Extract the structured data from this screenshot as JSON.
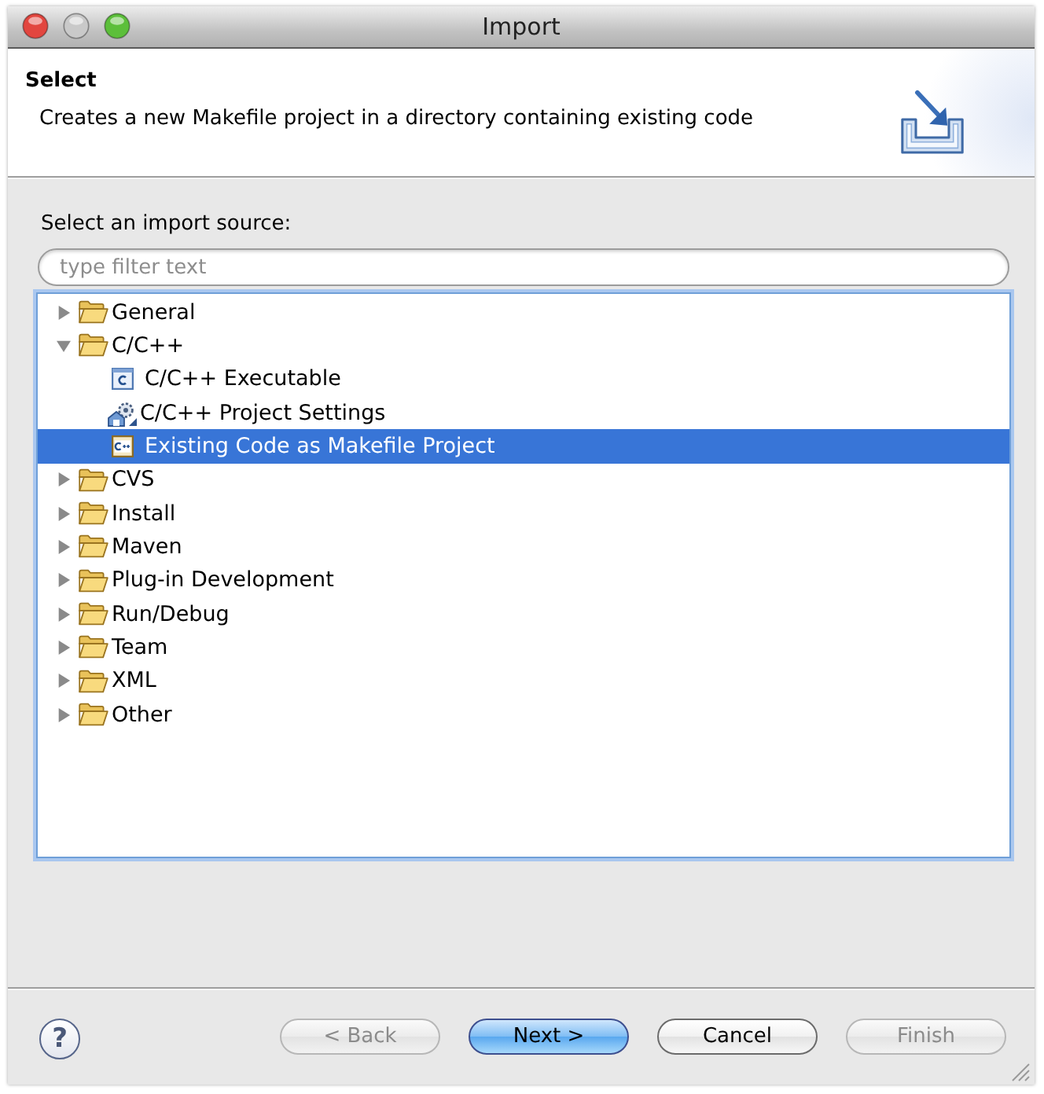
{
  "window": {
    "title": "Import",
    "controls": [
      {
        "kind": "close",
        "disabled": false
      },
      {
        "kind": "minimize",
        "disabled": true
      },
      {
        "kind": "zoom",
        "disabled": false
      }
    ]
  },
  "header": {
    "title": "Select",
    "description": "Creates a new Makefile project in a directory containing existing code"
  },
  "source": {
    "label": "Select an import source:",
    "filter": {
      "placeholder": "type filter text"
    }
  },
  "tree": {
    "items": [
      {
        "label": "General",
        "kind": "folder",
        "expanded": false,
        "selected": false
      },
      {
        "label": "C/C++",
        "kind": "folder",
        "expanded": true,
        "selected": false,
        "children": [
          {
            "label": "C/C++ Executable",
            "kind": "c-file",
            "selected": false
          },
          {
            "label": "C/C++ Project Settings",
            "kind": "settings",
            "selected": false
          },
          {
            "label": "Existing Code as Makefile Project",
            "kind": "cpp-file",
            "selected": true
          }
        ]
      },
      {
        "label": "CVS",
        "kind": "folder",
        "expanded": false,
        "selected": false
      },
      {
        "label": "Install",
        "kind": "folder",
        "expanded": false,
        "selected": false
      },
      {
        "label": "Maven",
        "kind": "folder",
        "expanded": false,
        "selected": false
      },
      {
        "label": "Plug-in Development",
        "kind": "folder",
        "expanded": false,
        "selected": false
      },
      {
        "label": "Run/Debug",
        "kind": "folder",
        "expanded": false,
        "selected": false
      },
      {
        "label": "Team",
        "kind": "folder",
        "expanded": false,
        "selected": false
      },
      {
        "label": "XML",
        "kind": "folder",
        "expanded": false,
        "selected": false
      },
      {
        "label": "Other",
        "kind": "folder",
        "expanded": false,
        "selected": false
      }
    ]
  },
  "help": {
    "label": "?"
  },
  "buttons": [
    {
      "label": "< Back",
      "disabled": true,
      "default": false
    },
    {
      "label": "Next >",
      "disabled": false,
      "default": true
    },
    {
      "label": "Cancel",
      "disabled": false,
      "default": false
    },
    {
      "label": "Finish",
      "disabled": true,
      "default": false
    }
  ]
}
